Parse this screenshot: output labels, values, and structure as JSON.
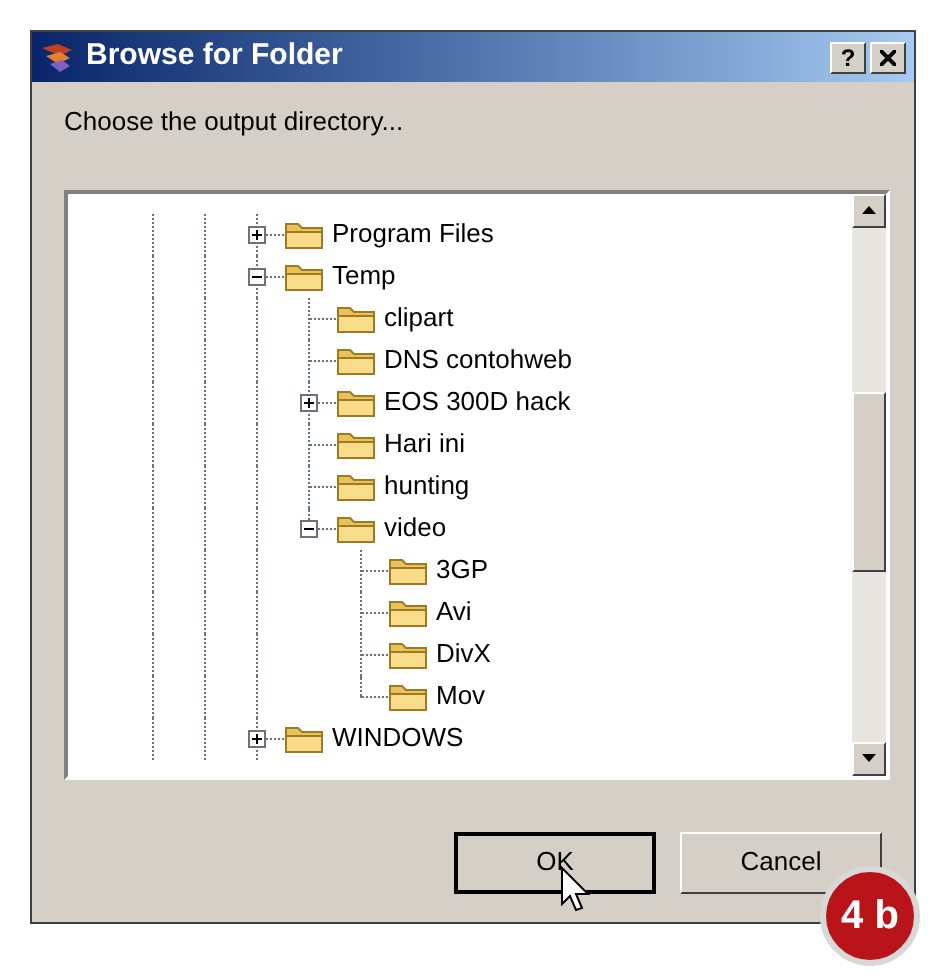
{
  "window": {
    "title": "Browse for Folder",
    "help_button": "?"
  },
  "prompt": "Choose the output directory...",
  "tree": [
    {
      "label": "Program Files",
      "kind": "branch",
      "expanded": false
    },
    {
      "label": "Temp",
      "kind": "branch",
      "expanded": true,
      "children": [
        {
          "label": "clipart",
          "kind": "leaf"
        },
        {
          "label": "DNS contohweb",
          "kind": "leaf"
        },
        {
          "label": "EOS 300D hack",
          "kind": "branch",
          "expanded": false
        },
        {
          "label": "Hari ini",
          "kind": "leaf"
        },
        {
          "label": "hunting",
          "kind": "leaf"
        },
        {
          "label": "video",
          "kind": "branch",
          "expanded": true,
          "children": [
            {
              "label": "3GP",
              "kind": "leaf"
            },
            {
              "label": "Avi",
              "kind": "leaf"
            },
            {
              "label": "DivX",
              "kind": "leaf"
            },
            {
              "label": "Mov",
              "kind": "leaf"
            }
          ]
        }
      ]
    },
    {
      "label": "WINDOWS",
      "kind": "branch",
      "expanded": false
    }
  ],
  "buttons": [
    {
      "label": "OK",
      "default": true
    },
    {
      "label": "Cancel",
      "default": false
    }
  ],
  "badge": "4 b"
}
